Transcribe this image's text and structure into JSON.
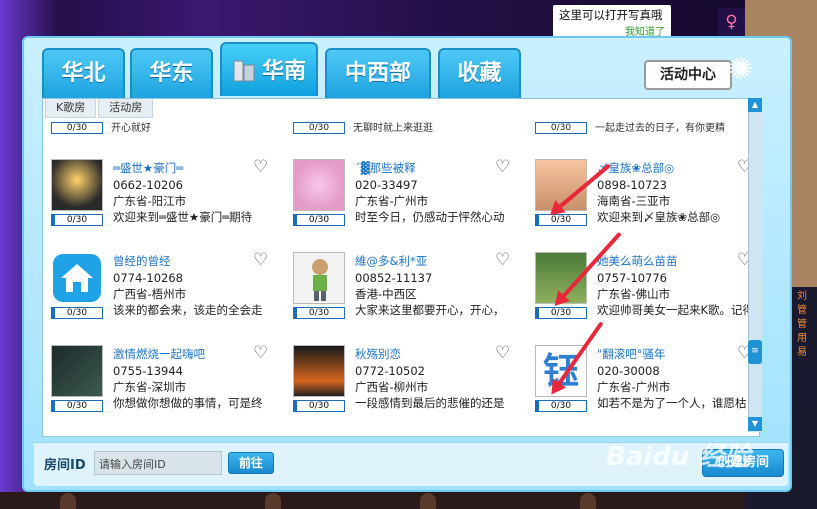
{
  "notice": {
    "text": "这里可以打开写真哦",
    "dismiss": "我知道了"
  },
  "tabs": [
    {
      "label": "华北"
    },
    {
      "label": "华东"
    },
    {
      "label": "华南"
    },
    {
      "label": "中西部"
    },
    {
      "label": "收藏"
    }
  ],
  "activity_center": "活动中心",
  "subtabs": [
    "K歌房",
    "活动房"
  ],
  "partial_row": [
    {
      "count": "0/30",
      "desc": "开心就好"
    },
    {
      "count": "0/30",
      "desc": "无聊时就上来逛逛"
    },
    {
      "count": "0/30",
      "desc": "一起走过去的日子，有你更精"
    }
  ],
  "rooms": [
    {
      "name": "═盛世★豪门═",
      "id": "0662-10206",
      "loc": "广东省-阳江市",
      "desc": "欢迎来到═盛世★豪门═期待",
      "count": "0/30"
    },
    {
      "name": "ˊ▓那些被释",
      "id": "020-33497",
      "loc": "广东省-广州市",
      "desc": "时至今日，仍感动于怦然心动",
      "count": "0/30"
    },
    {
      "name": "〆皇族❀总部◎",
      "id": "0898-10723",
      "loc": "海南省-三亚市",
      "desc": "欢迎来到〆皇族❀总部◎",
      "count": "0/30"
    },
    {
      "name": "曾经的曾经",
      "id": "0774-10268",
      "loc": "广西省-梧州市",
      "desc": "该来的都会来，该走的全会走",
      "count": "0/30"
    },
    {
      "name": "維@多&利*亚",
      "id": "00852-11137",
      "loc": "香港-中西区",
      "desc": "大家来这里都要开心，开心，",
      "count": "0/30"
    },
    {
      "name": "她美么萌么苗苗",
      "id": "0757-10776",
      "loc": "广东省-佛山市",
      "desc": "欢迎帅哥美女一起来K歌。记得",
      "count": "0/30"
    },
    {
      "name": "激情燃烧一起嗨吧",
      "id": "0755-13944",
      "loc": "广东省-深圳市",
      "desc": "你想做你想做的事情，可是终",
      "count": "0/30"
    },
    {
      "name": "秋殇别恋",
      "id": "0772-10502",
      "loc": "广西省-柳州市",
      "desc": "一段感情到最后的悲催的还是",
      "count": "0/30"
    },
    {
      "name": "\"翻滚吧°骚年",
      "id": "020-30008",
      "loc": "广东省-广州市",
      "desc": "如若不是为了一个人，谁愿枯",
      "count": "0/30"
    }
  ],
  "footer": {
    "label": "房间ID",
    "placeholder": "请输入房间ID",
    "go": "前往",
    "create": "创建房间"
  },
  "watermark": "Baidu 经验",
  "right_side_text": "刘\n管\n管\n用\n易"
}
